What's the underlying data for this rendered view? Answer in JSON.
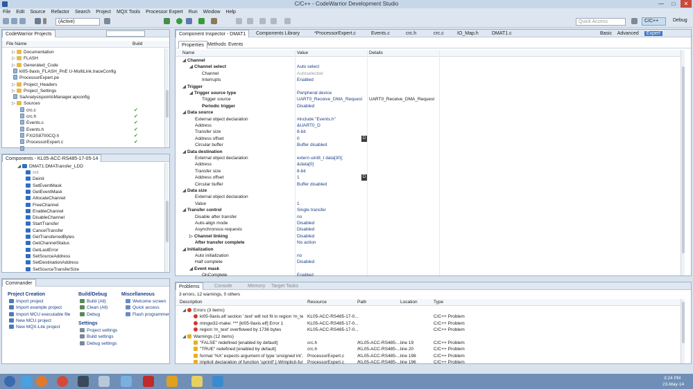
{
  "window": {
    "title": "C/C++ - CodeWarrior Development Studio",
    "min": "—",
    "max": "□",
    "close": "✕"
  },
  "menu": [
    "File",
    "Edit",
    "Source",
    "Refactor",
    "Search",
    "Project",
    "MQX Tools",
    "Processor Expert",
    "Run",
    "Window",
    "Help"
  ],
  "toolbar": {
    "config_combo": "(Active)",
    "quick_access_placeholder": "Quick Access",
    "perspective_cpp": "C/C++",
    "perspective_debug": "Debug"
  },
  "project_panel": {
    "title": "CodeWarrior Projects",
    "col_file_name": "File Name",
    "col_build": "Build",
    "items": [
      {
        "label": "Documentation",
        "icon": "folder",
        "indent": 1,
        "check": false
      },
      {
        "label": "FLASH",
        "icon": "folder",
        "indent": 1,
        "check": false
      },
      {
        "label": "Generated_Code",
        "icon": "folder",
        "indent": 1,
        "check": false
      },
      {
        "label": "kl05-9axis_FLASH_PnE U-MultiLink.traceConfig",
        "icon": "file",
        "indent": 1,
        "check": false
      },
      {
        "label": "ProcessorExpert.pe",
        "icon": "file",
        "indent": 1,
        "check": false
      },
      {
        "label": "Project_Headers",
        "icon": "folder",
        "indent": 1,
        "check": false
      },
      {
        "label": "Project_Settings",
        "icon": "folder",
        "indent": 1,
        "check": false
      },
      {
        "label": "SaAnalysispointsManager.apconfig",
        "icon": "file",
        "indent": 1,
        "check": false
      },
      {
        "label": "Sources",
        "icon": "folder",
        "indent": 1,
        "check": false
      },
      {
        "label": "crc.c",
        "icon": "file",
        "indent": 2,
        "check": true
      },
      {
        "label": "crc.h",
        "icon": "file",
        "indent": 2,
        "check": true
      },
      {
        "label": "Events.c",
        "icon": "file",
        "indent": 2,
        "check": true
      },
      {
        "label": "Events.h",
        "icon": "file",
        "indent": 2,
        "check": true
      },
      {
        "label": "FXOS8700CQ.h",
        "icon": "file",
        "indent": 2,
        "check": true
      },
      {
        "label": "ProcessorExpert.c",
        "icon": "file",
        "indent": 2,
        "check": true
      },
      {
        "label": "",
        "icon": "file",
        "indent": 2,
        "check": false
      }
    ]
  },
  "components_panel": {
    "title": "Components - KL05-ACC-RS485-17-05-14",
    "root": "DMAT1:DMATransfer_LDD",
    "methods": [
      "Init",
      "Deinit",
      "SetEventMask",
      "GetEventMask",
      "AllocateChannel",
      "FreeChannel",
      "EnableChannel",
      "DisableChannel",
      "StartTransfer",
      "CancelTransfer",
      "GetTransferredBytes",
      "GetChannelStatus",
      "GetLastError",
      "SetSourceAddress",
      "SetDestinationAddress",
      "SetSourceTransferSize"
    ]
  },
  "commander": {
    "title": "Commander",
    "project_creation": {
      "heading": "Project Creation",
      "items": [
        "Import project",
        "Import example project",
        "Import MCU executable file",
        "New MCU project",
        "New MQX-Lite project"
      ]
    },
    "build_debug": {
      "heading": "Build/Debug",
      "items": [
        "Build  (All)",
        "Clean  (All)",
        "Debug"
      ]
    },
    "settings": {
      "heading": "Settings",
      "items": [
        "Project settings",
        "Build settings",
        "Debug settings"
      ]
    },
    "misc": {
      "heading": "Miscellaneous",
      "items": [
        "Welcome screen",
        "Quick access",
        "Flash programmer"
      ]
    }
  },
  "editor_tabs": [
    "Component Inspector - DMAT1",
    "Components Library",
    "*ProcessorExpert.c",
    "Events.c",
    "crc.h",
    "crc.c",
    "IO_Map.h",
    "DMAT1.c"
  ],
  "inspector": {
    "modes": [
      "Basic",
      "Advanced",
      "Expert"
    ],
    "subtabs": [
      "Properties",
      "Methods",
      "Events"
    ],
    "col_name": "Name",
    "col_value": "Value",
    "col_details": "Details",
    "rows": [
      {
        "name": "Channel",
        "value": "",
        "details": "",
        "level": 0,
        "bold": true,
        "tri": "◢"
      },
      {
        "name": "Channel select",
        "value": "Auto select",
        "details": "",
        "level": 1,
        "bold": true,
        "tri": "◢"
      },
      {
        "name": "Channel",
        "value": "Autoselected",
        "details": "",
        "level": 2,
        "bold": false,
        "tri": "",
        "gray": true
      },
      {
        "name": "Interrupts",
        "value": "Enabled",
        "details": "",
        "level": 2,
        "bold": false,
        "tri": ""
      },
      {
        "name": "Trigger",
        "value": "",
        "details": "",
        "level": 0,
        "bold": true,
        "tri": "◢"
      },
      {
        "name": "Trigger source type",
        "value": "Peripheral device",
        "details": "",
        "level": 1,
        "bold": true,
        "tri": "◢"
      },
      {
        "name": "Trigger source",
        "value": "UART0_Receive_DMA_Request",
        "details": "UART0_Receive_DMA_Request",
        "level": 2,
        "bold": false,
        "tri": ""
      },
      {
        "name": "Periodic trigger",
        "value": "Disabled",
        "details": "",
        "level": 2,
        "bold": true,
        "tri": ""
      },
      {
        "name": "Data source",
        "value": "",
        "details": "",
        "level": 0,
        "bold": true,
        "tri": "◢"
      },
      {
        "name": "External object declaration",
        "value": "#include \"Events.h\"",
        "details": "",
        "level": 1,
        "bold": false,
        "tri": ""
      },
      {
        "name": "Address",
        "value": "&UART0_D",
        "details": "",
        "level": 1,
        "bold": false,
        "tri": ""
      },
      {
        "name": "Transfer size",
        "value": "8-bit",
        "details": "",
        "level": 1,
        "bold": false,
        "tri": ""
      },
      {
        "name": "Address offset",
        "value": "0",
        "details": "",
        "level": 1,
        "bold": false,
        "tri": "",
        "dbtn": true
      },
      {
        "name": "Circular buffer",
        "value": "Buffer disabled",
        "details": "",
        "level": 1,
        "bold": false,
        "tri": ""
      },
      {
        "name": "Data destination",
        "value": "",
        "details": "",
        "level": 0,
        "bold": true,
        "tri": "◢"
      },
      {
        "name": "External object declaration",
        "value": "extern uint8_t data[30];",
        "details": "",
        "level": 1,
        "bold": false,
        "tri": ""
      },
      {
        "name": "Address",
        "value": "&data[0]",
        "details": "",
        "level": 1,
        "bold": false,
        "tri": ""
      },
      {
        "name": "Transfer size",
        "value": "8-bit",
        "details": "",
        "level": 1,
        "bold": false,
        "tri": ""
      },
      {
        "name": "Address offset",
        "value": "1",
        "details": "",
        "level": 1,
        "bold": false,
        "tri": "",
        "dbtn": true
      },
      {
        "name": "Circular buffer",
        "value": "Buffer disabled",
        "details": "",
        "level": 1,
        "bold": false,
        "tri": ""
      },
      {
        "name": "Data size",
        "value": "",
        "details": "",
        "level": 0,
        "bold": true,
        "tri": "◢"
      },
      {
        "name": "External object declaration",
        "value": "",
        "details": "",
        "level": 1,
        "bold": false,
        "tri": ""
      },
      {
        "name": "Value",
        "value": "1",
        "details": "",
        "level": 1,
        "bold": false,
        "tri": ""
      },
      {
        "name": "Transfer control",
        "value": "Single transfer",
        "details": "",
        "level": 0,
        "bold": true,
        "tri": "◢"
      },
      {
        "name": "Disable after transfer",
        "value": "no",
        "details": "",
        "level": 1,
        "bold": false,
        "tri": ""
      },
      {
        "name": "Auto-align mode",
        "value": "Disabled",
        "details": "",
        "level": 1,
        "bold": false,
        "tri": ""
      },
      {
        "name": "Asynchronous requests",
        "value": "Disabled",
        "details": "",
        "level": 1,
        "bold": false,
        "tri": ""
      },
      {
        "name": "Channel linking",
        "value": "Disabled",
        "details": "",
        "level": 1,
        "bold": true,
        "tri": "▷"
      },
      {
        "name": "After transfer complete",
        "value": "No action",
        "details": "",
        "level": 1,
        "bold": true,
        "tri": ""
      },
      {
        "name": "Initialization",
        "value": "",
        "details": "",
        "level": 0,
        "bold": true,
        "tri": "◢"
      },
      {
        "name": "Auto initialization",
        "value": "no",
        "details": "",
        "level": 1,
        "bold": false,
        "tri": ""
      },
      {
        "name": "Half complete",
        "value": "Disabled",
        "details": "",
        "level": 1,
        "bold": false,
        "tri": ""
      },
      {
        "name": "Event mask",
        "value": "",
        "details": "",
        "level": 1,
        "bold": true,
        "tri": "◢"
      },
      {
        "name": "OnComplete",
        "value": "Enabled",
        "details": "",
        "level": 2,
        "bold": false,
        "tri": ""
      }
    ]
  },
  "problems": {
    "tabs": [
      "Problems",
      "Console",
      "Memory",
      "Target Tasks"
    ],
    "summary": "3 errors, 12 warnings, 0 others",
    "cols": [
      "Description",
      "Resource",
      "Path",
      "Location",
      "Type"
    ],
    "rows": [
      {
        "kind": "group",
        "desc": "Errors (3 items)",
        "icon": "err",
        "resource": "",
        "path": "",
        "location": "",
        "type": ""
      },
      {
        "kind": "item",
        "desc": "kl05-9axis.elf section '.text' will not fit in region 'm_text'",
        "icon": "err",
        "resource": "KL05-ACC-RS485-17-0...",
        "path": "",
        "location": "",
        "type": "C/C++ Problem"
      },
      {
        "kind": "item",
        "desc": "mingw32-make: *** [kl05-9axis.elf] Error 1",
        "icon": "err",
        "resource": "KL05-ACC-RS485-17-0...",
        "path": "",
        "location": "",
        "type": "C/C++ Problem"
      },
      {
        "kind": "item",
        "desc": "region 'm_text' overflowed by 1736 bytes",
        "icon": "err",
        "resource": "KL05-ACC-RS485-17-0...",
        "path": "",
        "location": "",
        "type": "C/C++ Problem"
      },
      {
        "kind": "group",
        "desc": "Warnings (12 items)",
        "icon": "warn",
        "resource": "",
        "path": "",
        "location": "",
        "type": ""
      },
      {
        "kind": "item",
        "desc": "\"FALSE\" redefined [enabled by default]",
        "icon": "warn",
        "resource": "crc.h",
        "path": "/KL05-ACC-RS485-...",
        "location": "line 19",
        "type": "C/C++ Problem"
      },
      {
        "kind": "item",
        "desc": "\"TRUE\" redefined [enabled by default]",
        "icon": "warn",
        "resource": "crc.h",
        "path": "/KL05-ACC-RS485-...",
        "location": "line 20",
        "type": "C/C++ Problem"
      },
      {
        "kind": "item",
        "desc": "format '%X' expects argument of type 'unsigned int', bu",
        "icon": "warn",
        "resource": "ProcessorExpert.c",
        "path": "/KL05-ACC-RS485-...",
        "location": "line 198",
        "type": "C/C++ Problem"
      },
      {
        "kind": "item",
        "desc": "implicit declaration of function 'sprintf' [-Wimplicit-fun",
        "icon": "warn",
        "resource": "ProcessorExpert.c",
        "path": "/KL05-ACC-RS485-...",
        "location": "line 196",
        "type": "C/C++ Problem"
      }
    ]
  },
  "taskbar": {
    "time": "3:24 PM",
    "date": "23-May-14"
  }
}
